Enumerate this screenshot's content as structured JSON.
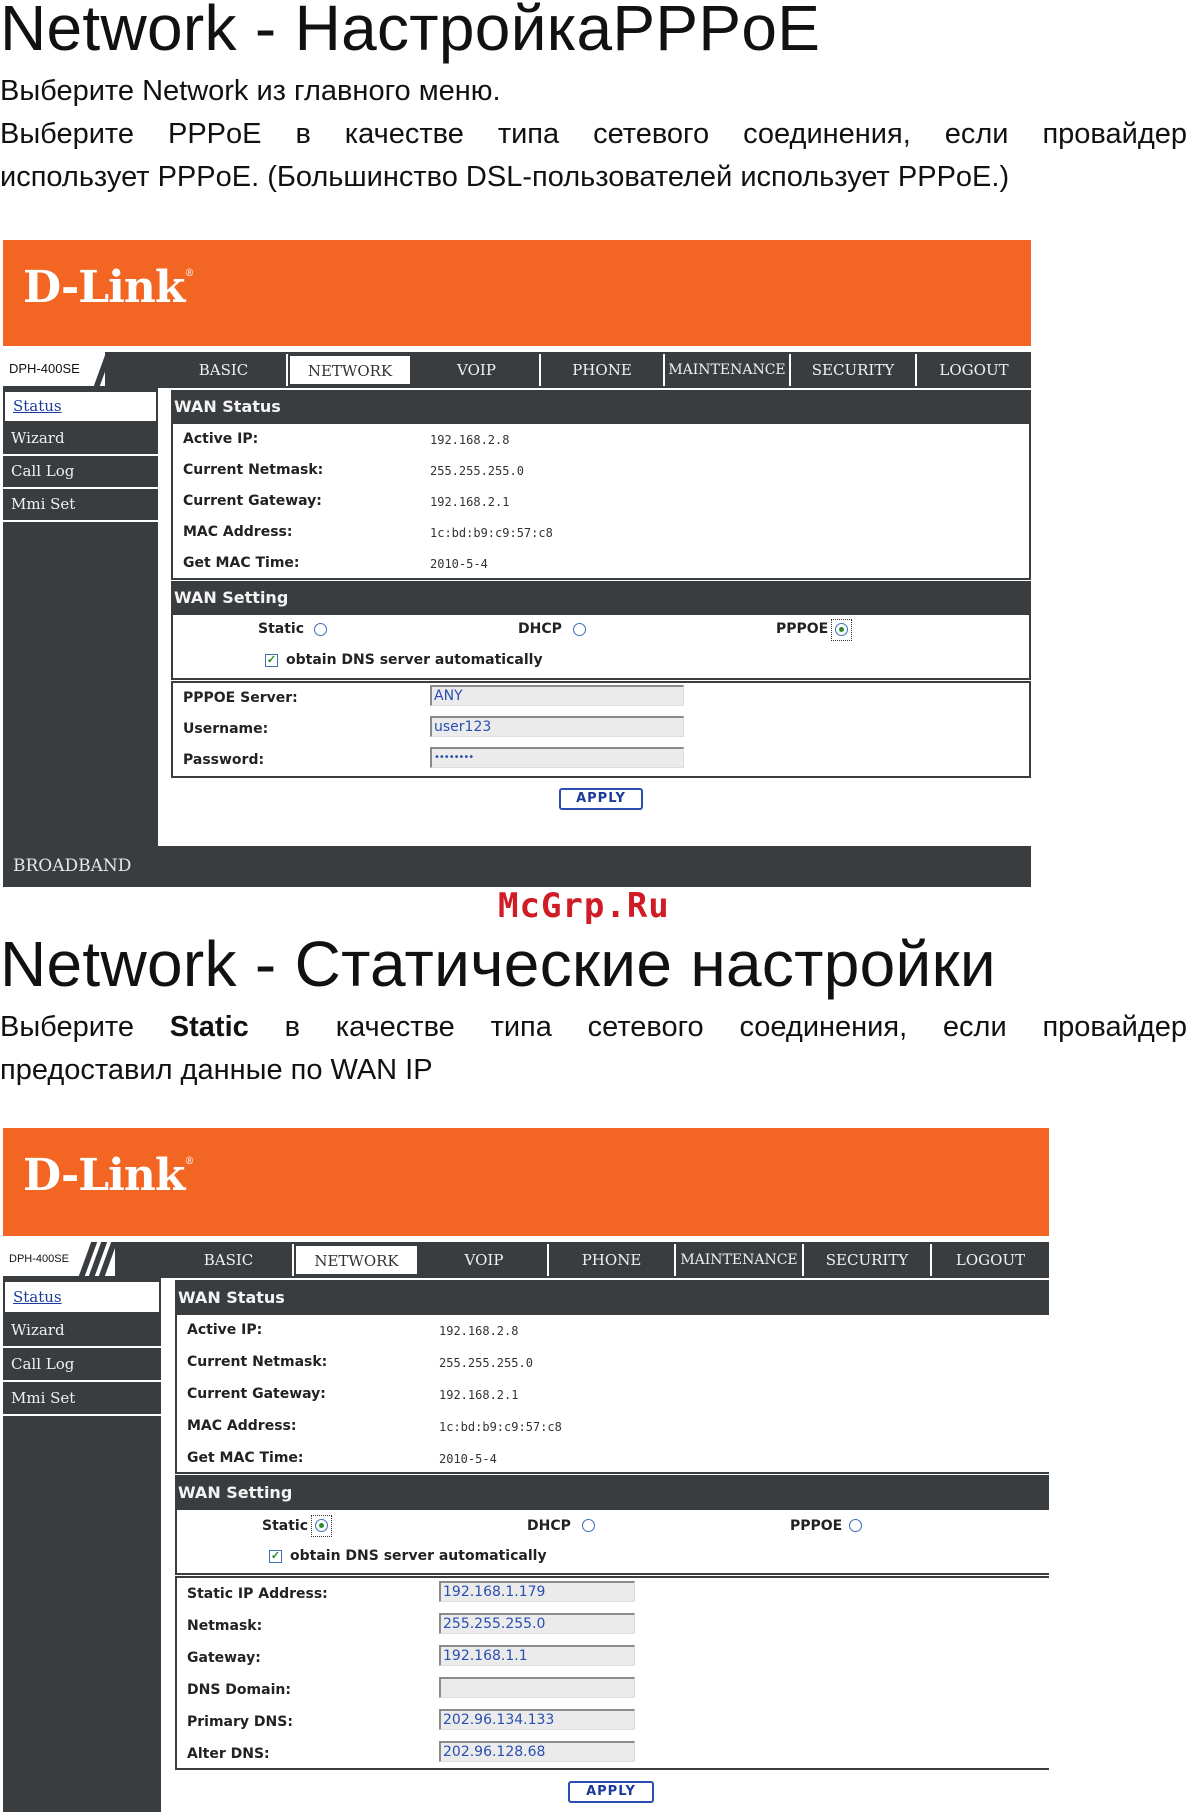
{
  "section1": {
    "title": "Network - НастройкаPPPoE",
    "para_lines": [
      "Выберите Network из главного меню.",
      "Выберите PPPoE в качестве типа сетевого соединения, если провайдер",
      "использует PPPoE. (Большинство DSL-пользователей использует PPPoE.)"
    ]
  },
  "watermark": "McGrp.Ru",
  "section2": {
    "title": "Network -  Статические настройки",
    "para_line1_pre": "Выберите",
    "para_line1_bold": "Static",
    "para_line1_post": "в качестве типа сетевого соединения, если провайдер",
    "para_line2": "предоставил данные по WAN IP"
  },
  "ui": {
    "logo": "D-Link",
    "logo_mark": "®",
    "model": "DPH-400SE",
    "tabs": [
      "BASIC",
      "NETWORK",
      "VOIP",
      "PHONE",
      "MAINTENANCE",
      "SECURITY",
      "LOGOUT"
    ],
    "sidebar": [
      "Status",
      "Wizard",
      "Call Log",
      "Mmi Set"
    ],
    "wan_status_title": "WAN Status",
    "status_rows": [
      {
        "label": "Active IP:",
        "value": "192.168.2.8"
      },
      {
        "label": "Current Netmask:",
        "value": "255.255.255.0"
      },
      {
        "label": "Current Gateway:",
        "value": "192.168.2.1"
      },
      {
        "label": "MAC Address:",
        "value": "1c:bd:b9:c9:57:c8"
      },
      {
        "label": "Get MAC Time:",
        "value": "2010-5-4"
      }
    ],
    "wan_setting_title": "WAN Setting",
    "radio_static": "Static",
    "radio_dhcp": "DHCP",
    "radio_pppoe": "PPPOE",
    "dns_checkbox": "obtain DNS server automatically",
    "apply": "APPLY",
    "footer": "BROADBAND"
  },
  "pppoe_fields": [
    {
      "label": "PPPOE Server:",
      "value": "ANY"
    },
    {
      "label": "Username:",
      "value": "user123"
    },
    {
      "label": "Password:",
      "value": "••••••••"
    }
  ],
  "static_fields": [
    {
      "label": "Static IP Address:",
      "value": "192.168.1.179"
    },
    {
      "label": "Netmask:",
      "value": "255.255.255.0"
    },
    {
      "label": "Gateway:",
      "value": "192.168.1.1"
    },
    {
      "label": "DNS Domain:",
      "value": ""
    },
    {
      "label": "Primary DNS:",
      "value": "202.96.134.133"
    },
    {
      "label": "Alter DNS:",
      "value": "202.96.128.68"
    }
  ]
}
